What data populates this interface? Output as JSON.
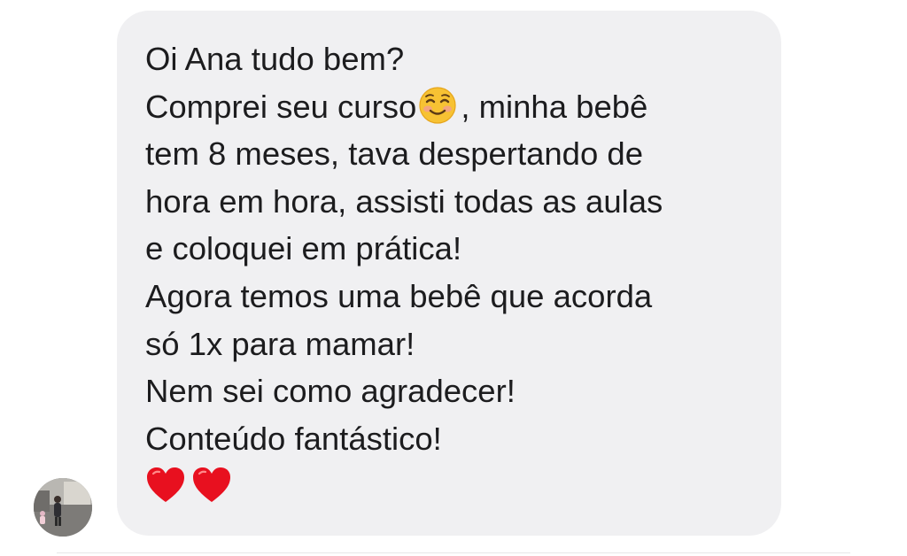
{
  "message": {
    "lines": [
      "Oi Ana tudo bem?",
      "Comprei seu curso",
      ", minha bebê",
      "tem 8 meses, tava despertando de",
      "hora em hora, assisti todas as aulas",
      "e coloquei em prática!",
      "Agora temos uma bebê que acorda",
      "só 1x para mamar!",
      "Nem sei como agradecer!",
      "Conteúdo fantástico!"
    ],
    "inline_emoji": "smiling-face-icon",
    "reactions": [
      "heart-icon",
      "heart-icon"
    ]
  },
  "colors": {
    "bubble": "#f0f0f2",
    "text": "#1c1c1e",
    "heart": "#e8101f",
    "emoji": "#f7c233"
  }
}
